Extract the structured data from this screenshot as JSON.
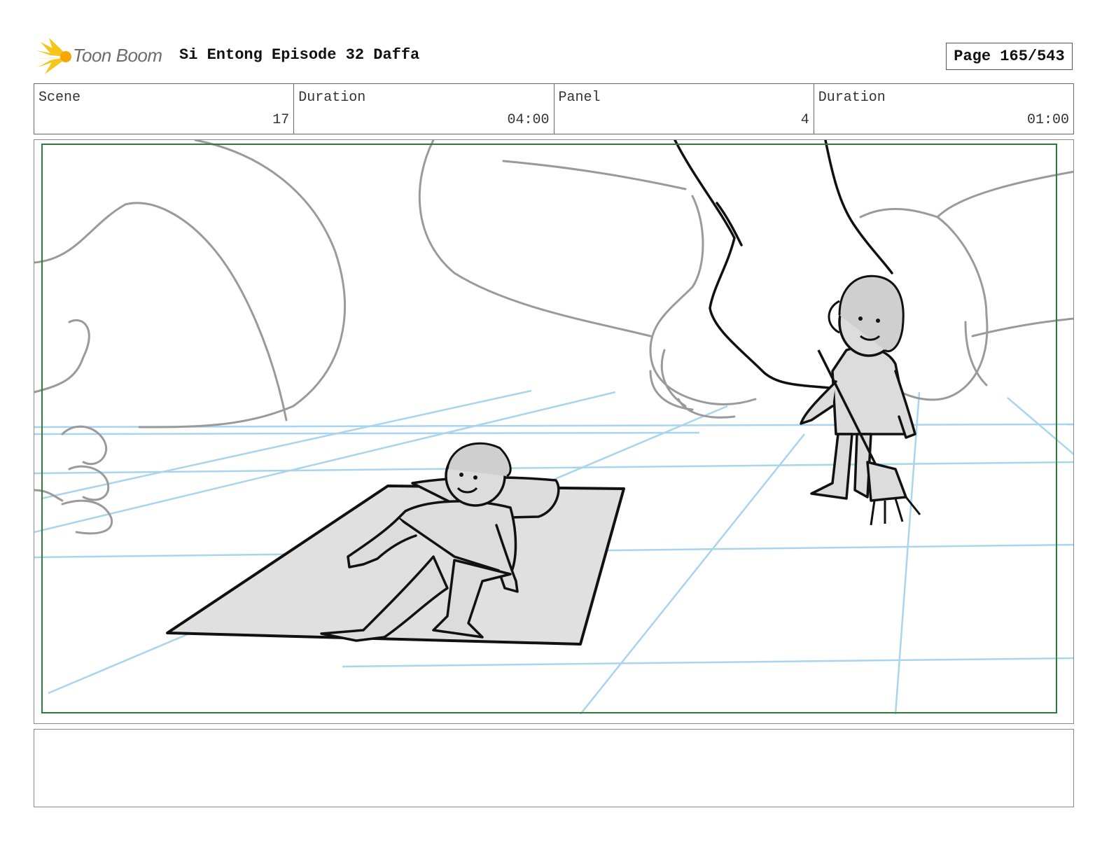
{
  "header": {
    "logo_text": "Toon Boom",
    "title": "Si Entong Episode 32 Daffa",
    "page_label": "Page 165/543"
  },
  "info": {
    "scene_label": "Scene",
    "scene_value": "17",
    "scene_duration_label": "Duration",
    "scene_duration_value": "04:00",
    "panel_label": "Panel",
    "panel_value": "4",
    "panel_duration_label": "Duration",
    "panel_duration_value": "01:00"
  },
  "colors": {
    "safe_frame": "#2e7d32",
    "guide_lines": "#a9d4ee",
    "rough_sketch": "#9a9a9a",
    "ink": "#111111",
    "mat_fill": "#e0e0e0"
  },
  "notes": {
    "text": ""
  }
}
